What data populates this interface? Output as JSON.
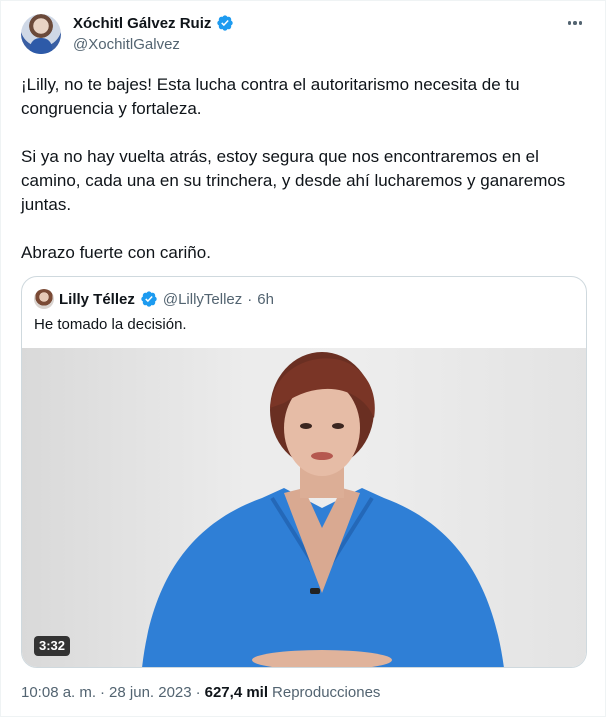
{
  "author": {
    "name": "Xóchitl Gálvez Ruiz",
    "handle": "@XochitlGalvez",
    "verified": true
  },
  "tweet": {
    "paragraphs": [
      "¡Lilly, no te bajes! Esta lucha contra el autoritarismo necesita de tu congruencia y fortaleza.",
      "Si ya no hay vuelta atrás, estoy segura que nos encontraremos en el camino, cada una en su trinchera, y desde ahí lucharemos y ganaremos juntas.",
      "Abrazo fuerte con cariño."
    ]
  },
  "quote": {
    "name": "Lilly Téllez",
    "handle": "@LillyTellez",
    "separator": "·",
    "time": "6h",
    "text": "He tomado la decisión.",
    "video_duration": "3:32"
  },
  "meta": {
    "time": "10:08 a. m.",
    "sep1": "·",
    "date": "28 jun. 2023",
    "sep2": "·",
    "views": "627,4 mil",
    "views_label": "Reproducciones"
  },
  "colors": {
    "verified_blue": "#1d9bf0",
    "secondary_text": "#536471",
    "blouse_blue": "#2f7fd6"
  }
}
